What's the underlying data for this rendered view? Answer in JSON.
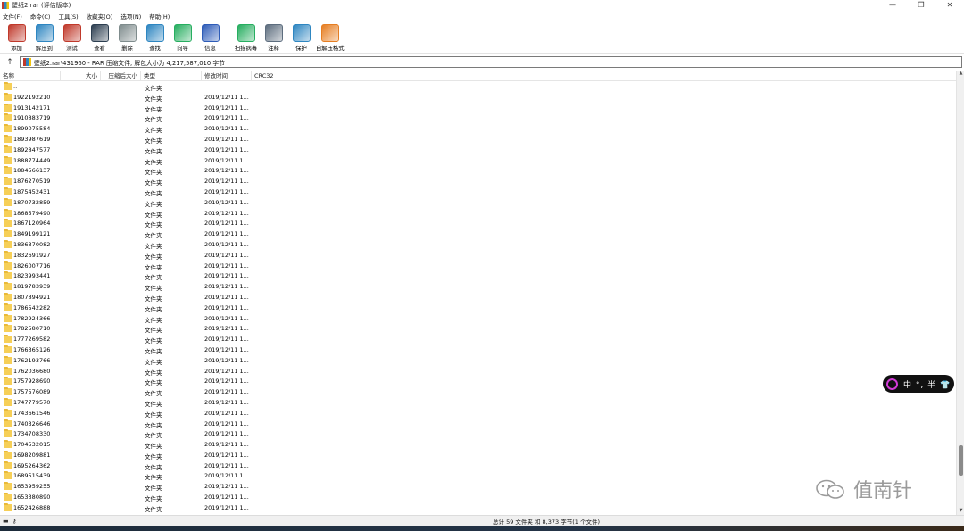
{
  "window": {
    "title": "壁纸2.rar (评估版本)",
    "controls": [
      "—",
      "❐",
      "✕"
    ]
  },
  "menu": [
    "文件(F)",
    "命令(C)",
    "工具(S)",
    "收藏夹(O)",
    "选项(N)",
    "帮助(H)"
  ],
  "toolbar": {
    "group1": [
      {
        "label": "添加",
        "icon": "add-archive-icon",
        "color": "#c0392b"
      },
      {
        "label": "解压到",
        "icon": "extract-folder-icon",
        "color": "#2e86c1"
      },
      {
        "label": "测试",
        "icon": "test-icon",
        "color": "#c0392b"
      },
      {
        "label": "查看",
        "icon": "view-book-icon",
        "color": "#2c3e50"
      },
      {
        "label": "删除",
        "icon": "trash-icon",
        "color": "#7f8c8d"
      },
      {
        "label": "查找",
        "icon": "magnifier-icon",
        "color": "#2e86c1"
      },
      {
        "label": "向导",
        "icon": "wizard-wand-icon",
        "color": "#27ae60"
      },
      {
        "label": "信息",
        "icon": "info-icon",
        "color": "#2e5cb8"
      }
    ],
    "group2": [
      {
        "label": "扫描病毒",
        "icon": "virus-scan-icon",
        "color": "#27ae60"
      },
      {
        "label": "注释",
        "icon": "comment-icon",
        "color": "#5d6d7e"
      },
      {
        "label": "保护",
        "icon": "shield-icon",
        "color": "#2e86c1"
      },
      {
        "label": "自解压格式",
        "icon": "sfx-archive-icon",
        "color": "#e67e22"
      }
    ]
  },
  "address": {
    "up_symbol": "↑",
    "path": "壁纸2.rar\\431960 - RAR 压缩文件, 解包大小为 4,217,587,010 字节"
  },
  "columns": {
    "name": "名称",
    "size": "大小",
    "packed": "压缩后大小",
    "type": "类型",
    "modified": "修改时间",
    "crc": "CRC32"
  },
  "rows": [
    {
      "name": "..",
      "type": "文件夹",
      "modified": ""
    },
    {
      "name": "1922192210",
      "type": "文件夹",
      "modified": "2019/12/11 1..."
    },
    {
      "name": "1913142171",
      "type": "文件夹",
      "modified": "2019/12/11 1..."
    },
    {
      "name": "1910883719",
      "type": "文件夹",
      "modified": "2019/12/11 1..."
    },
    {
      "name": "1899075584",
      "type": "文件夹",
      "modified": "2019/12/11 1..."
    },
    {
      "name": "1893987619",
      "type": "文件夹",
      "modified": "2019/12/11 1..."
    },
    {
      "name": "1892847577",
      "type": "文件夹",
      "modified": "2019/12/11 1..."
    },
    {
      "name": "1888774449",
      "type": "文件夹",
      "modified": "2019/12/11 1..."
    },
    {
      "name": "1884566137",
      "type": "文件夹",
      "modified": "2019/12/11 1..."
    },
    {
      "name": "1876270519",
      "type": "文件夹",
      "modified": "2019/12/11 1..."
    },
    {
      "name": "1875452431",
      "type": "文件夹",
      "modified": "2019/12/11 1..."
    },
    {
      "name": "1870732859",
      "type": "文件夹",
      "modified": "2019/12/11 1..."
    },
    {
      "name": "1868579490",
      "type": "文件夹",
      "modified": "2019/12/11 1..."
    },
    {
      "name": "1867120964",
      "type": "文件夹",
      "modified": "2019/12/11 1..."
    },
    {
      "name": "1849199121",
      "type": "文件夹",
      "modified": "2019/12/11 1..."
    },
    {
      "name": "1836370082",
      "type": "文件夹",
      "modified": "2019/12/11 1..."
    },
    {
      "name": "1832691927",
      "type": "文件夹",
      "modified": "2019/12/11 1..."
    },
    {
      "name": "1826007716",
      "type": "文件夹",
      "modified": "2019/12/11 1..."
    },
    {
      "name": "1823993441",
      "type": "文件夹",
      "modified": "2019/12/11 1..."
    },
    {
      "name": "1819783939",
      "type": "文件夹",
      "modified": "2019/12/11 1..."
    },
    {
      "name": "1807894921",
      "type": "文件夹",
      "modified": "2019/12/11 1..."
    },
    {
      "name": "1786542282",
      "type": "文件夹",
      "modified": "2019/12/11 1..."
    },
    {
      "name": "1782924366",
      "type": "文件夹",
      "modified": "2019/12/11 1..."
    },
    {
      "name": "1782580710",
      "type": "文件夹",
      "modified": "2019/12/11 1..."
    },
    {
      "name": "1777269582",
      "type": "文件夹",
      "modified": "2019/12/11 1..."
    },
    {
      "name": "1766365126",
      "type": "文件夹",
      "modified": "2019/12/11 1..."
    },
    {
      "name": "1762193766",
      "type": "文件夹",
      "modified": "2019/12/11 1..."
    },
    {
      "name": "1762036680",
      "type": "文件夹",
      "modified": "2019/12/11 1..."
    },
    {
      "name": "1757928690",
      "type": "文件夹",
      "modified": "2019/12/11 1..."
    },
    {
      "name": "1757576089",
      "type": "文件夹",
      "modified": "2019/12/11 1..."
    },
    {
      "name": "1747779570",
      "type": "文件夹",
      "modified": "2019/12/11 1..."
    },
    {
      "name": "1743661546",
      "type": "文件夹",
      "modified": "2019/12/11 1..."
    },
    {
      "name": "1740326646",
      "type": "文件夹",
      "modified": "2019/12/11 1..."
    },
    {
      "name": "1734708330",
      "type": "文件夹",
      "modified": "2019/12/11 1..."
    },
    {
      "name": "1704532015",
      "type": "文件夹",
      "modified": "2019/12/11 1..."
    },
    {
      "name": "1698209881",
      "type": "文件夹",
      "modified": "2019/12/11 1..."
    },
    {
      "name": "1695264362",
      "type": "文件夹",
      "modified": "2019/12/11 1..."
    },
    {
      "name": "1689515439",
      "type": "文件夹",
      "modified": "2019/12/11 1..."
    },
    {
      "name": "1653959255",
      "type": "文件夹",
      "modified": "2019/12/11 1..."
    },
    {
      "name": "1653380890",
      "type": "文件夹",
      "modified": "2019/12/11 1..."
    },
    {
      "name": "1652426888",
      "type": "文件夹",
      "modified": "2019/12/11 1..."
    }
  ],
  "status": {
    "text": "总计 59 文件夹 和 8,373 字节(1 个文件)",
    "left_icons": [
      "drive-icon",
      "key-icon"
    ]
  },
  "scroll": {
    "position_fraction": 0.92,
    "visible_fraction": 0.07
  },
  "ime": {
    "text": "中 °, 半 👕"
  },
  "watermark": {
    "text": "值南针"
  }
}
